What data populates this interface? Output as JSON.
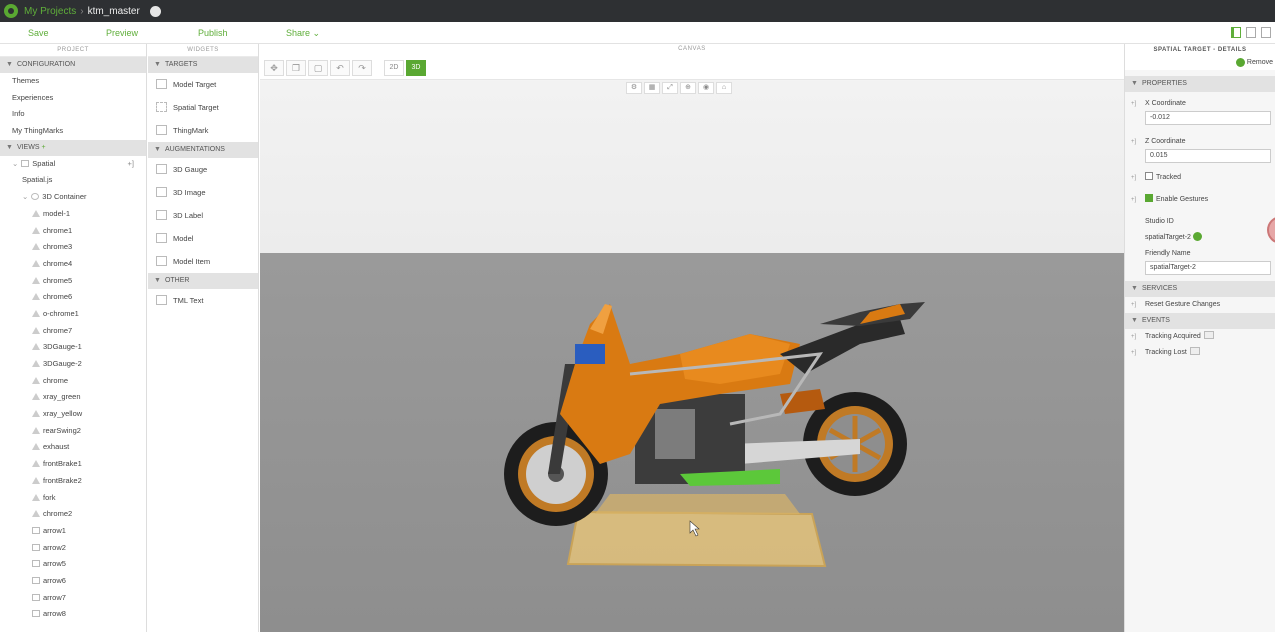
{
  "titlebar": {
    "crumb_root": "My Projects",
    "crumb_sep": "›",
    "crumb_current": "ktm_master"
  },
  "toolbar": {
    "save": "Save",
    "preview": "Preview",
    "publish": "Publish",
    "share": "Share ⌄"
  },
  "project_panel": {
    "header": "PROJECT",
    "configuration_label": "CONFIGURATION",
    "configuration_items": [
      "Themes",
      "Experiences",
      "Info",
      "My ThingMarks"
    ],
    "views_label": "VIEWS",
    "views_add": "+",
    "spatial": "Spatial",
    "spatial_js": "Spatial.js",
    "container": "3D Container",
    "tree_items": [
      "model-1",
      "chrome1",
      "chrome3",
      "chrome4",
      "chrome5",
      "chrome6",
      "o-chrome1",
      "chrome7",
      "3DGauge-1",
      "3DGauge-2",
      "chrome",
      "xray_green",
      "xray_yellow",
      "rearSwing2",
      "exhaust",
      "frontBrake1",
      "frontBrake2",
      "fork",
      "chrome2",
      "arrow1",
      "arrow2",
      "arrow5",
      "arrow6",
      "arrow7",
      "arrow8"
    ]
  },
  "widgets_panel": {
    "header": "WIDGETS",
    "targets_label": "TARGETS",
    "targets": [
      "Model Target",
      "Spatial Target",
      "ThingMark"
    ],
    "augmentations_label": "AUGMENTATIONS",
    "augmentations": [
      "3D Gauge",
      "3D Image",
      "3D Label",
      "Model",
      "Model Item"
    ],
    "other_label": "OTHER",
    "other": [
      "TML Text"
    ]
  },
  "canvas": {
    "header": "CANVAS",
    "btn_2d": "2D",
    "btn_3d": "3D"
  },
  "details": {
    "title": "SPATIAL TARGET - DETAILS",
    "remove": "Remove",
    "properties_label": "PROPERTIES",
    "x_label": "X Coordinate",
    "x_value": "-0.012",
    "z_label": "Z Coordinate",
    "z_value": "0.015",
    "tracked_label": "Tracked",
    "gestures_label": "Enable Gestures",
    "studio_id_label": "Studio ID",
    "studio_id_value": "spatialTarget-2",
    "friendly_label": "Friendly Name",
    "friendly_value": "spatialTarget-2",
    "services_label": "SERVICES",
    "services": [
      "Reset Gesture Changes"
    ],
    "events_label": "EVENTS",
    "events": [
      "Tracking Acquired",
      "Tracking Lost"
    ]
  },
  "colors": {
    "accent": "#5aa832",
    "titlebar": "#2e3033",
    "bike_orange": "#d97a12"
  }
}
